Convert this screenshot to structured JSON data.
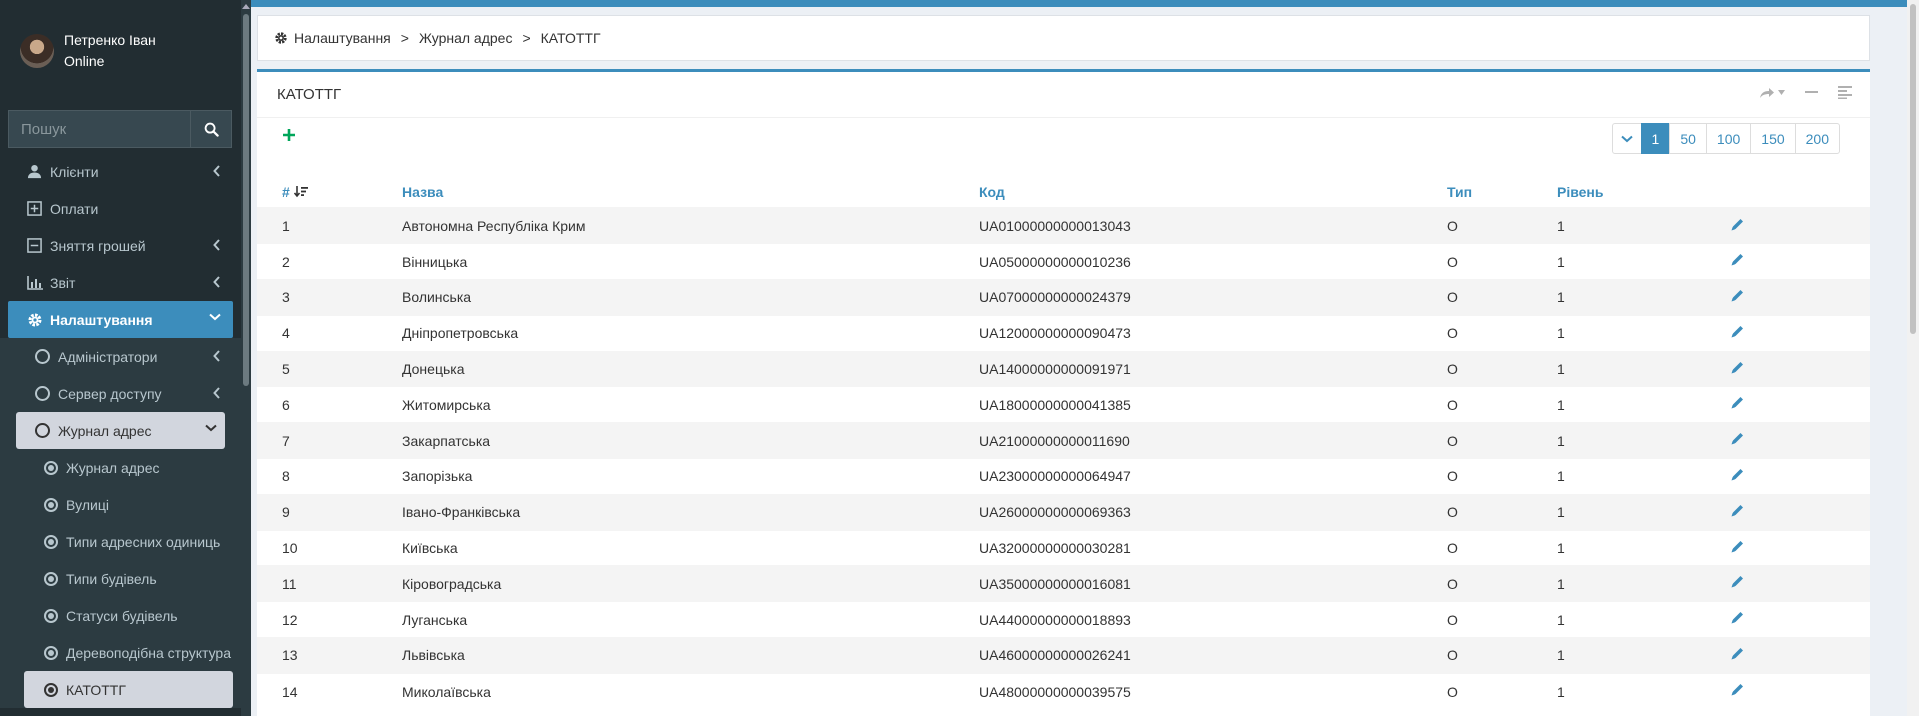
{
  "user": {
    "name": "Петренко Іван",
    "status": "Online"
  },
  "search": {
    "placeholder": "Пошук"
  },
  "menu": {
    "clients": "Клієнти",
    "payments": "Оплати",
    "withdraw": "Зняття грошей",
    "report": "Звіт",
    "settings": "Налаштування",
    "admins": "Адміністратори",
    "access_server": "Сервер доступу",
    "address_log": "Журнал адрес",
    "sub": {
      "address_log": "Журнал адрес",
      "streets": "Вулиці",
      "address_unit_types": "Типи адресних одиниць",
      "building_types": "Типи будівель",
      "building_statuses": "Статуси будівель",
      "tree_structure": "Деревоподібна структура",
      "katottg": "КАТОТТГ"
    }
  },
  "breadcrumb": {
    "item1": "Налаштування",
    "sep": ">",
    "item2": "Журнал адрес",
    "item3": "КАТОТТГ"
  },
  "box": {
    "title": "КАТОТТГ"
  },
  "pager": {
    "p1": "1",
    "p2": "50",
    "p3": "100",
    "p4": "150",
    "p5": "200"
  },
  "table": {
    "headers": {
      "num": "#",
      "name": "Назва",
      "code": "Код",
      "type": "Тип",
      "level": "Рівень"
    },
    "rows": [
      {
        "num": "1",
        "name": "Автономна Республіка Крим",
        "code": "UA01000000000013043",
        "type": "O",
        "level": "1"
      },
      {
        "num": "2",
        "name": "Вінницька",
        "code": "UA05000000000010236",
        "type": "O",
        "level": "1"
      },
      {
        "num": "3",
        "name": "Волинська",
        "code": "UA07000000000024379",
        "type": "O",
        "level": "1"
      },
      {
        "num": "4",
        "name": "Дніпропетровська",
        "code": "UA12000000000090473",
        "type": "O",
        "level": "1"
      },
      {
        "num": "5",
        "name": "Донецька",
        "code": "UA14000000000091971",
        "type": "O",
        "level": "1"
      },
      {
        "num": "6",
        "name": "Житомирська",
        "code": "UA18000000000041385",
        "type": "O",
        "level": "1"
      },
      {
        "num": "7",
        "name": "Закарпатська",
        "code": "UA21000000000011690",
        "type": "O",
        "level": "1"
      },
      {
        "num": "8",
        "name": "Запорізька",
        "code": "UA23000000000064947",
        "type": "O",
        "level": "1"
      },
      {
        "num": "9",
        "name": "Івано-Франківська",
        "code": "UA26000000000069363",
        "type": "O",
        "level": "1"
      },
      {
        "num": "10",
        "name": "Київська",
        "code": "UA32000000000030281",
        "type": "O",
        "level": "1"
      },
      {
        "num": "11",
        "name": "Кіровоградська",
        "code": "UA35000000000016081",
        "type": "O",
        "level": "1"
      },
      {
        "num": "12",
        "name": "Луганська",
        "code": "UA44000000000018893",
        "type": "O",
        "level": "1"
      },
      {
        "num": "13",
        "name": "Львівська",
        "code": "UA46000000000026241",
        "type": "O",
        "level": "1"
      },
      {
        "num": "14",
        "name": "Миколаївська",
        "code": "UA48000000000039575",
        "type": "O",
        "level": "1"
      }
    ]
  },
  "colors": {
    "accent": "#3c8dbc",
    "sidebar": "#222d32",
    "add": "#00a65a"
  }
}
